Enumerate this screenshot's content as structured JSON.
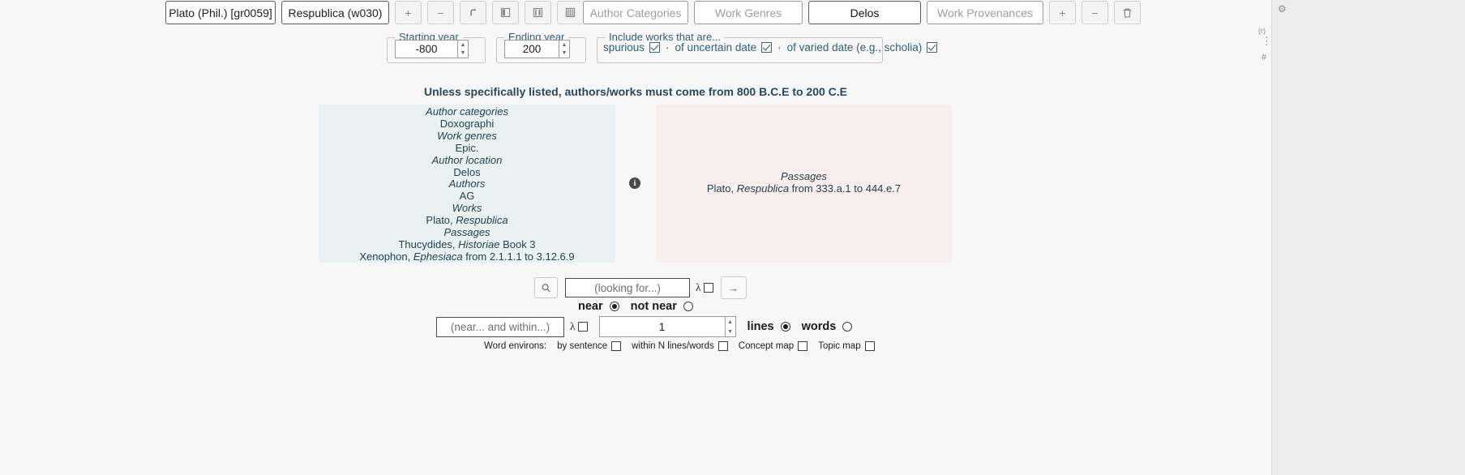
{
  "toolbar": {
    "author_button": "Plato (Phil.) [gr0059]",
    "work_button": "Respublica (w030)",
    "add_icon": "+",
    "remove_icon": "−",
    "swap_icon": "↰",
    "book_icon": "book-icon",
    "notebook_icon": "notebook-icon",
    "grid_icon": "grid-icon",
    "person_icon": "person-icon",
    "author_categories_button": "Author Categories",
    "work_genres_button": "Work Genres",
    "author_location_button": "Delos",
    "work_provenances_button": "Work Provenances",
    "add_icon_2": "+",
    "remove_icon_2": "−",
    "trash_icon": "trash-icon"
  },
  "dates": {
    "starting_legend": "Starting year",
    "starting_value": "-800",
    "ending_legend": "Ending year",
    "ending_value": "200",
    "include_legend": "Include works that are...",
    "include_options": [
      {
        "label": "spurious",
        "checked": true
      },
      {
        "label": "of uncertain date",
        "checked": true
      },
      {
        "label": "of varied date (e.g., scholia)",
        "checked": true
      }
    ],
    "separator": "·"
  },
  "headline": "Unless specifically listed, authors/works must come from 800 B.C.E to 200 C.E",
  "selection_panel": {
    "lines": [
      {
        "text": "Author categories",
        "style": "italic"
      },
      {
        "text": "Doxographi",
        "style": "plain"
      },
      {
        "text": "Work genres",
        "style": "italic"
      },
      {
        "text": "Epic.",
        "style": "plain"
      },
      {
        "text": "Author location",
        "style": "italic"
      },
      {
        "text": "Delos",
        "style": "plain"
      },
      {
        "text": "Authors",
        "style": "italic"
      },
      {
        "text": "AG",
        "style": "plain"
      },
      {
        "text": "Works",
        "style": "italic"
      },
      {
        "text": "Plato, Respublica",
        "style": "mixed",
        "pre": "Plato, ",
        "em": "Respublica",
        "post": ""
      },
      {
        "text": "Passages",
        "style": "italic"
      },
      {
        "text": "Thucydides, Historiae Book 3",
        "style": "mixed",
        "pre": "Thucydides, ",
        "em": "Historiae",
        "post": " Book 3"
      },
      {
        "text": "Xenophon, Ephesiaca from 2.1.1.1 to 3.12.6.9",
        "style": "mixed",
        "pre": "Xenophon, ",
        "em": "Ephesiaca",
        "post": " from 2.1.1.1 to 3.12.6.9"
      }
    ]
  },
  "exclusion_panel": {
    "lines": [
      {
        "text": "Passages",
        "style": "italic"
      },
      {
        "text": "Plato, Respublica from 333.a.1 to 444.e.7",
        "style": "mixed",
        "pre": "Plato, ",
        "em": "Respublica",
        "post": " from 333.a.1 to 444.e.7"
      }
    ]
  },
  "info_icon_label": "i",
  "search": {
    "search_icon": "magnifier-icon",
    "input_value": "",
    "input_placeholder": "(looking for...)",
    "lambda_label": "λ",
    "lambda_checked": false,
    "submit_icon": "→"
  },
  "proximity": {
    "near_label": "near",
    "near_selected": true,
    "not_near_label": "not near",
    "not_near_selected": false
  },
  "within": {
    "input_value": "",
    "input_placeholder": "(near... and within...)",
    "lambda_label": "λ",
    "lambda_checked": false,
    "distance_value": "1",
    "lines_label": "lines",
    "lines_selected": true,
    "words_label": "words",
    "words_selected": false
  },
  "environs": {
    "title": "Word environs:",
    "options": [
      {
        "label": "by sentence",
        "checked": false
      },
      {
        "label": "within N lines/words",
        "checked": false
      },
      {
        "label": "Concept map",
        "checked": false
      },
      {
        "label": "Topic map",
        "checked": false
      }
    ]
  },
  "right_strip": {
    "gear": "⚙",
    "r_mark": "(r)",
    "dots": "⋮",
    "hash": "#"
  },
  "colors": {
    "selection_panel_bg": "#eaf1f3",
    "exclusion_panel_bg": "#f9eeee",
    "accent_text": "#2e5f78",
    "page_bg": "#f7f7f7"
  }
}
